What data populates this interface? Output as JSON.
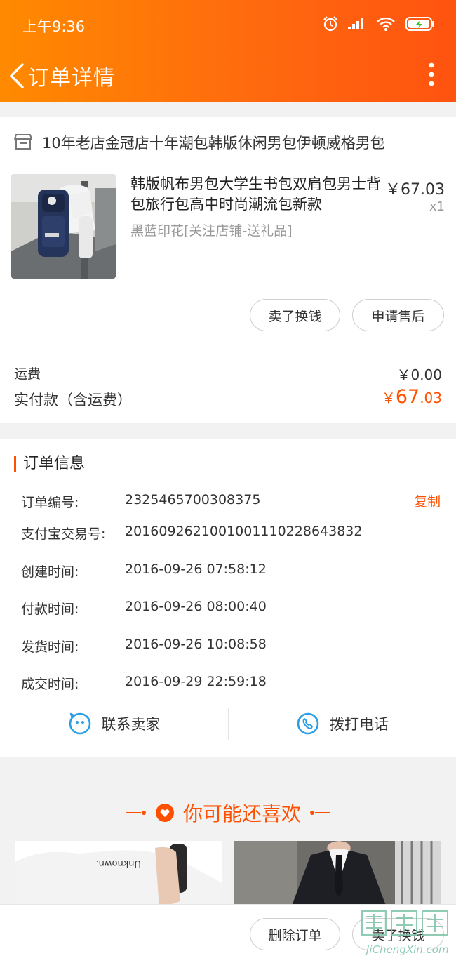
{
  "status_bar": {
    "time": "上午9:36"
  },
  "nav": {
    "title": "订单详情"
  },
  "shop": {
    "name": "10年老店金冠店十年潮包韩版休闲男包伊顿威格男包"
  },
  "product": {
    "title": "韩版帆布男包大学生书包双肩包男士背包旅行包高中时尚潮流包新款",
    "sku": "黑蓝印花[关注店铺-送礼品]",
    "price": "￥67.03",
    "qty": "x1"
  },
  "actions": {
    "sell_label": "卖了换钱",
    "after_sale_label": "申请售后"
  },
  "fees": {
    "shipping_label": "运费",
    "shipping_value": "￥0.00",
    "paid_label": "实付款（含运费）",
    "paid_currency": "￥",
    "paid_int": "67",
    "paid_dec": ".03"
  },
  "order_info": {
    "title": "订单信息",
    "copy_label": "复制",
    "rows": [
      {
        "label": "订单编号:",
        "value": "2325465700308375"
      },
      {
        "label": "支付宝交易号:",
        "value": "2016092621001001110228643832"
      },
      {
        "label": "创建时间:",
        "value": "2016-09-26 07:58:12"
      },
      {
        "label": "付款时间:",
        "value": "2016-09-26 08:00:40"
      },
      {
        "label": "发货时间:",
        "value": "2016-09-26 10:08:58"
      },
      {
        "label": "成交时间:",
        "value": "2016-09-29 22:59:18"
      }
    ]
  },
  "contact": {
    "seller_label": "联系卖家",
    "call_label": "拨打电话"
  },
  "recommend": {
    "title": "你可能还喜欢",
    "shirt_print": "Unknown."
  },
  "bottom": {
    "delete_label": "删除订单",
    "sell_label": "卖了换钱"
  },
  "watermark": {
    "text": "JiChengXin.com"
  },
  "colors": {
    "accent": "#ff5000",
    "header_from": "#ff8a00",
    "header_to": "#ff5310",
    "contact_icon": "#2a9fe6"
  },
  "icons": [
    "alarm-icon",
    "signal-icon",
    "wifi-icon",
    "battery-icon",
    "back-arrow-icon",
    "more-icon",
    "shop-icon",
    "chevron-right-icon",
    "wangwang-icon",
    "phone-icon",
    "heart-icon"
  ]
}
